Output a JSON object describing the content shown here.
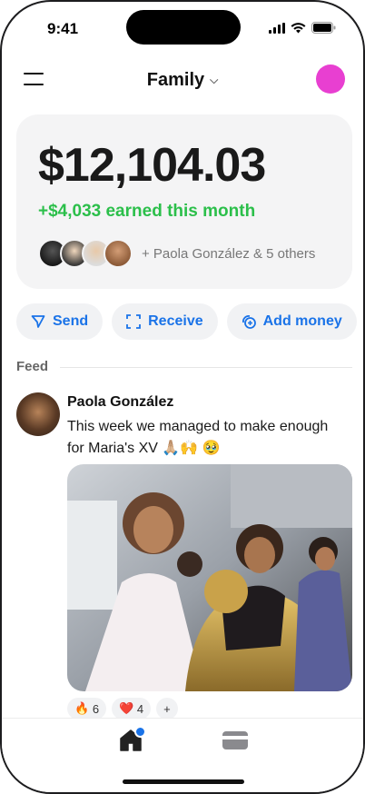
{
  "status": {
    "time": "9:41"
  },
  "header": {
    "title": "Family",
    "chevron_icon": "chevron-down-icon",
    "menu_icon": "hamburger-menu-icon"
  },
  "colors": {
    "accent": "#1a73e8",
    "earned": "#2bbf4a",
    "avatar": "#e83fd1"
  },
  "balance": {
    "amount": "$12,104.03",
    "earned": "+$4,033 earned this month",
    "members_text": "+ Paola González & 5 others"
  },
  "actions": [
    {
      "label": "Send",
      "icon": "send-icon"
    },
    {
      "label": "Receive",
      "icon": "scan-icon"
    },
    {
      "label": "Add money",
      "icon": "add-money-icon"
    }
  ],
  "feed": {
    "label": "Feed",
    "post": {
      "author": "Paola González",
      "text": "This week we managed to make enough for Maria's XV 🙏🏼🙌 🥹",
      "reactions": [
        {
          "emoji": "🔥",
          "count": "6"
        },
        {
          "emoji": "❤️",
          "count": "4"
        },
        {
          "emoji": "+",
          "count": ""
        }
      ]
    }
  },
  "tabbar": {
    "items": [
      {
        "name": "home",
        "icon": "home-icon"
      },
      {
        "name": "card",
        "icon": "card-icon"
      }
    ]
  }
}
